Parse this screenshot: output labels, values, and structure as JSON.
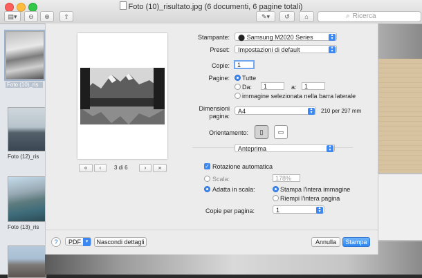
{
  "window": {
    "title": "Foto (10)_risultato.jpg (6 documenti, 6 pagine totali)",
    "search_placeholder": "Ricerca"
  },
  "sidebar": {
    "items": [
      {
        "caption": "Foto (10)_ris"
      },
      {
        "caption": "Foto (12)_ris"
      },
      {
        "caption": "Foto (13)_ris"
      }
    ]
  },
  "print": {
    "pager": {
      "first": "«",
      "prev": "‹",
      "label": "3 di 6",
      "next": "›",
      "last": "»"
    },
    "printer_label": "Stampante:",
    "printer_value": "Samsung M2020 Series",
    "preset_label": "Preset:",
    "preset_value": "Impostazioni di default",
    "copies_label": "Copie:",
    "copies_value": "1",
    "pages_label": "Pagine:",
    "pages_all": "Tutte",
    "pages_from_label": "Da:",
    "pages_from_value": "1",
    "pages_to_label": "a:",
    "pages_to_value": "1",
    "pages_selected": "immagine selezionata nella barra laterale",
    "paper_label_1": "Dimensioni",
    "paper_label_2": "pagina:",
    "paper_value": "A4",
    "paper_size": "210 per 297 mm",
    "orientation_label": "Orientamento:",
    "section_value": "Anteprima",
    "auto_rotate": "Rotazione automatica",
    "scale_label": "Scala:",
    "scale_value": "178%",
    "fit_label": "Adatta in scala:",
    "fit_whole": "Stampa l'intera immagine",
    "fit_fill": "Riempi l'intera pagina",
    "copies_per_page_label": "Copie per pagina:",
    "copies_per_page_value": "1",
    "help": "?",
    "pdf": "PDF",
    "hide_details": "Nascondi dettagli",
    "cancel": "Annulla",
    "print": "Stampa"
  }
}
